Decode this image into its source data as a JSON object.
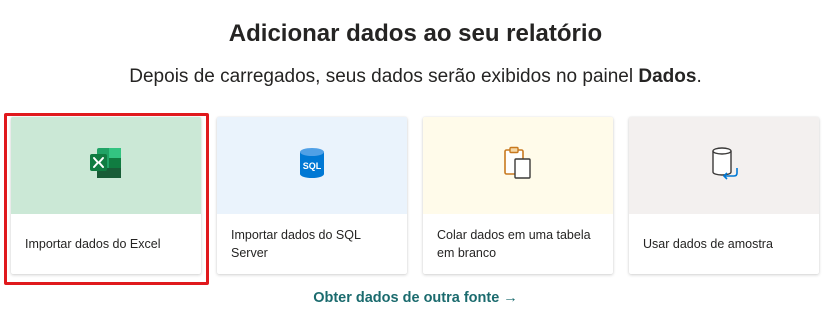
{
  "header": {
    "title": "Adicionar dados ao seu relatório",
    "subtitle_prefix": "Depois de carregados, seus dados serão exibidos no painel ",
    "subtitle_bold": "Dados",
    "subtitle_suffix": "."
  },
  "cards": [
    {
      "label": "Importar dados do Excel",
      "icon": "excel-icon",
      "top_color": "#cbe8d6",
      "selected": true
    },
    {
      "label": "Importar dados do SQL Server",
      "icon": "sql-server-icon",
      "top_color": "#eaf3fc"
    },
    {
      "label": "Colar dados em uma tabela em branco",
      "icon": "paste-icon",
      "top_color": "#fffbea"
    },
    {
      "label": "Usar dados de amostra",
      "icon": "sample-data-icon",
      "top_color": "#f3f0ef"
    }
  ],
  "footer": {
    "link_label": "Obter dados de outra fonte →"
  },
  "colors": {
    "highlight": "#e0191d",
    "link": "#1b6b6e"
  }
}
